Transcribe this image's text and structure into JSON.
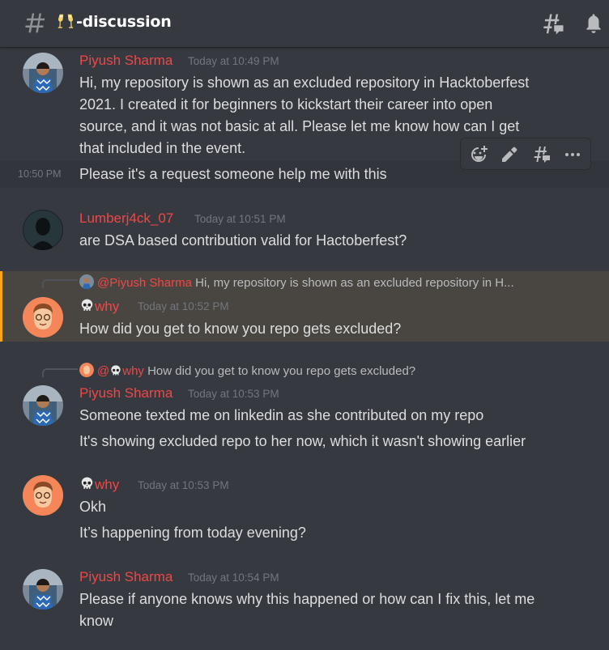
{
  "header": {
    "channel_name": "-discussion",
    "channel_emoji": "champagne-glasses-icon"
  },
  "toolbar": {
    "items": [
      "add-reaction-icon",
      "edit-icon",
      "create-thread-icon",
      "more-icon"
    ]
  },
  "messages": [
    {
      "author": "Piyush Sharma",
      "timestamp": "Today at 10:49 PM",
      "lines": [
        "Hi, my repository is shown as an excluded repository in Hacktoberfest",
        "2021. I created it for beginners to kickstart their career into open",
        "source, and it was not basic at all. Please let me know how can I get",
        "that included in the event."
      ]
    },
    {
      "short_time": "10:50 PM",
      "text": "Please it's a request someone help me with this"
    },
    {
      "author": "Lumberj4ck_07",
      "timestamp": "Today at 10:51 PM",
      "text": "are DSA based contribution valid for Hactoberfest?"
    },
    {
      "reply_to_author": "@Piyush Sharma",
      "reply_to_text": "Hi, my repository is shown as an excluded repository in H...",
      "author": "why",
      "timestamp": "Today at 10:52 PM",
      "text": "How did you get to know you repo gets excluded?"
    },
    {
      "reply_to_author": "@",
      "reply_to_author_name": "why",
      "reply_to_text": "How did you get to know you repo gets excluded?",
      "author": "Piyush Sharma",
      "timestamp": "Today at 10:53 PM",
      "lines": [
        "Someone texted me on linkedin as she contributed on my repo",
        "It's showing excluded repo to her now, which it wasn't showing earlier"
      ]
    },
    {
      "author": "why",
      "timestamp": "Today at 10:53 PM",
      "lines": [
        "Okh",
        "It’s happening from today evening?"
      ]
    },
    {
      "author": "Piyush Sharma",
      "timestamp": "Today at 10:54 PM",
      "lines": [
        "Please if anyone knows why this happened or how can I fix this, let me",
        "know"
      ]
    }
  ],
  "colors": {
    "background": "#36393f",
    "username": "#f04747",
    "mention_highlight": "#494641",
    "mention_bar": "#faa61a",
    "timestamp": "#72767d",
    "text": "#dcddde"
  }
}
